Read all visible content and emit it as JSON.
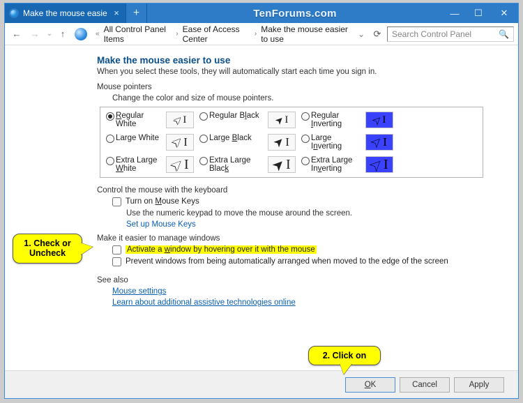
{
  "window": {
    "tab_title": "Make the mouse easie",
    "watermark": "TenForums.com"
  },
  "wincontrols": {
    "min": "—",
    "max": "☐",
    "close": "✕"
  },
  "navbar": {
    "back": "←",
    "forward": "→",
    "up": "↑",
    "first_chev": "«",
    "crumbs": [
      "All Control Panel Items",
      "Ease of Access Center",
      "Make the mouse easier to use"
    ],
    "dropdown_glyph": "⌄",
    "refresh_glyph": "⟳"
  },
  "search": {
    "placeholder": "Search Control Panel",
    "mag": "🔍"
  },
  "page": {
    "title": "Make the mouse easier to use",
    "subtitle": "When you select these tools, they will automatically start each time you sign in."
  },
  "pointers": {
    "section_label": "Mouse pointers",
    "subtitle": "Change the color and size of mouse pointers.",
    "options": [
      {
        "label_html": "<u>R</u>egular<br>White",
        "size": "reg",
        "scheme": "white",
        "selected": true
      },
      {
        "label_html": "Regular B<u>l</u>ack",
        "size": "reg",
        "scheme": "black",
        "selected": false
      },
      {
        "label_html": "Regular<br><u>I</u>nverting",
        "size": "reg",
        "scheme": "inv",
        "selected": false
      },
      {
        "label_html": "Lar<u>g</u>e White",
        "size": "lg",
        "scheme": "white",
        "selected": false
      },
      {
        "label_html": "Large <u>B</u>lack",
        "size": "lg",
        "scheme": "black",
        "selected": false
      },
      {
        "label_html": "Large<br>I<u>n</u>verting",
        "size": "lg",
        "scheme": "inv",
        "selected": false
      },
      {
        "label_html": "Extra Large<br><u>W</u>hite",
        "size": "xl",
        "scheme": "white",
        "selected": false
      },
      {
        "label_html": "Extra Large<br>Blac<u>k</u>",
        "size": "xl",
        "scheme": "black",
        "selected": false
      },
      {
        "label_html": "Extra Large<br>In<u>v</u>erting",
        "size": "xl",
        "scheme": "inv",
        "selected": false
      }
    ]
  },
  "keyboard_mouse": {
    "section_label": "Control the mouse with the keyboard",
    "mouse_keys_html": "Turn on <u>M</u>ouse Keys",
    "description": "Use the numeric keypad to move the mouse around the screen.",
    "setup_link": "Set up Mouse Keys"
  },
  "manage_windows": {
    "section_label": "Make it easier to manage windows",
    "activate_hover_html": "Activate a <u>w</u>indow by hovering over it with the mouse",
    "prevent_arrange_html": "Prevent windows from being automatically arranged when moved to the edge of the screen"
  },
  "see_also": {
    "label": "See also",
    "mouse_settings": "Mouse settings",
    "assistive": "Learn about additional assistive technologies online"
  },
  "buttons": {
    "ok_html": "<u>O</u>K",
    "cancel": "Cancel",
    "apply": "Apply"
  },
  "callouts": {
    "one": "1. Check or\nUncheck",
    "two": "2. Click on"
  }
}
